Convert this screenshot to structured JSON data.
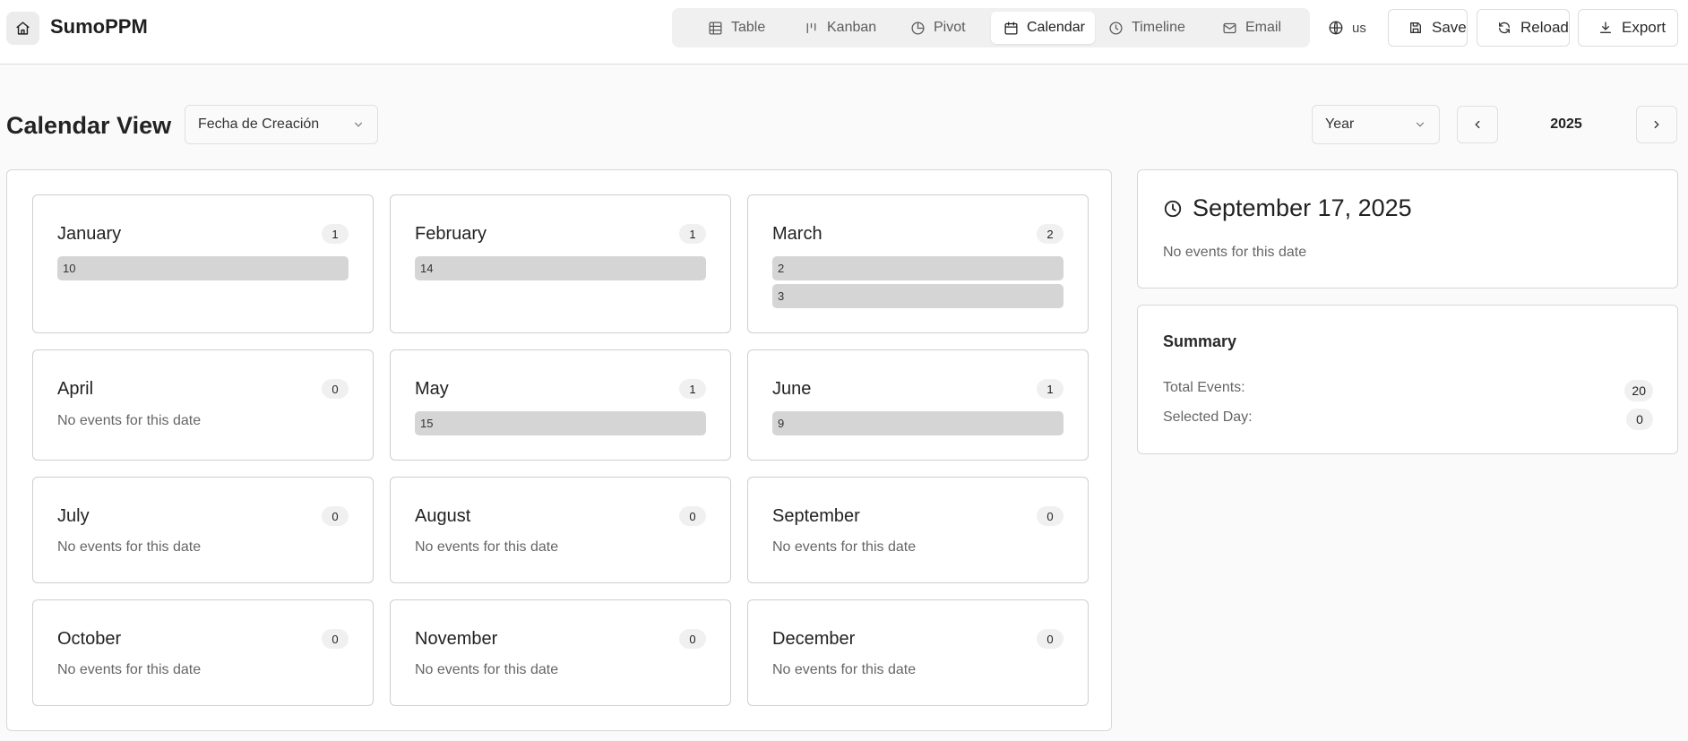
{
  "app": {
    "name": "SumoPPM",
    "home_icon": "home-icon"
  },
  "views": [
    {
      "label": "Table",
      "icon": "table-icon",
      "active": false
    },
    {
      "label": "Kanban",
      "icon": "kanban-icon",
      "active": false
    },
    {
      "label": "Pivot",
      "icon": "pie-chart-icon",
      "active": false
    },
    {
      "label": "Calendar",
      "icon": "calendar-icon",
      "active": true
    },
    {
      "label": "Timeline",
      "icon": "clock-icon",
      "active": false
    },
    {
      "label": "Email",
      "icon": "mail-icon",
      "active": false
    }
  ],
  "language": {
    "code": "us",
    "icon": "globe-icon"
  },
  "actions": {
    "save": "Save",
    "reload": "Reload",
    "export": "Export"
  },
  "toolbar": {
    "title": "Calendar View",
    "date_field": "Fecha de Creación",
    "period": "Year",
    "year": "2025"
  },
  "months": [
    {
      "name": "January",
      "count": "1",
      "events": [
        "10"
      ],
      "empty_text": ""
    },
    {
      "name": "February",
      "count": "1",
      "events": [
        "14"
      ],
      "empty_text": ""
    },
    {
      "name": "March",
      "count": "2",
      "events": [
        "2",
        "3"
      ],
      "empty_text": ""
    },
    {
      "name": "April",
      "count": "0",
      "events": [],
      "empty_text": "No events for this date"
    },
    {
      "name": "May",
      "count": "1",
      "events": [
        "15"
      ],
      "empty_text": ""
    },
    {
      "name": "June",
      "count": "1",
      "events": [
        "9"
      ],
      "empty_text": ""
    },
    {
      "name": "July",
      "count": "0",
      "events": [],
      "empty_text": "No events for this date"
    },
    {
      "name": "August",
      "count": "0",
      "events": [],
      "empty_text": "No events for this date"
    },
    {
      "name": "September",
      "count": "0",
      "events": [],
      "empty_text": "No events for this date"
    },
    {
      "name": "October",
      "count": "0",
      "events": [],
      "empty_text": "No events for this date"
    },
    {
      "name": "November",
      "count": "0",
      "events": [],
      "empty_text": "No events for this date"
    },
    {
      "name": "December",
      "count": "0",
      "events": [],
      "empty_text": "No events for this date"
    }
  ],
  "selected_date": {
    "title": "September 17, 2025",
    "empty_text": "No events for this date",
    "icon": "clock-icon"
  },
  "summary": {
    "title": "Summary",
    "total_events_label": "Total Events:",
    "total_events": "20",
    "selected_day_label": "Selected Day:",
    "selected_day": "0"
  },
  "colors": {
    "background": "#fafafa",
    "card": "#ffffff",
    "event_bar": "#d5d5d5",
    "badge": "#f0f0f0",
    "border": "#cfcfcf"
  }
}
